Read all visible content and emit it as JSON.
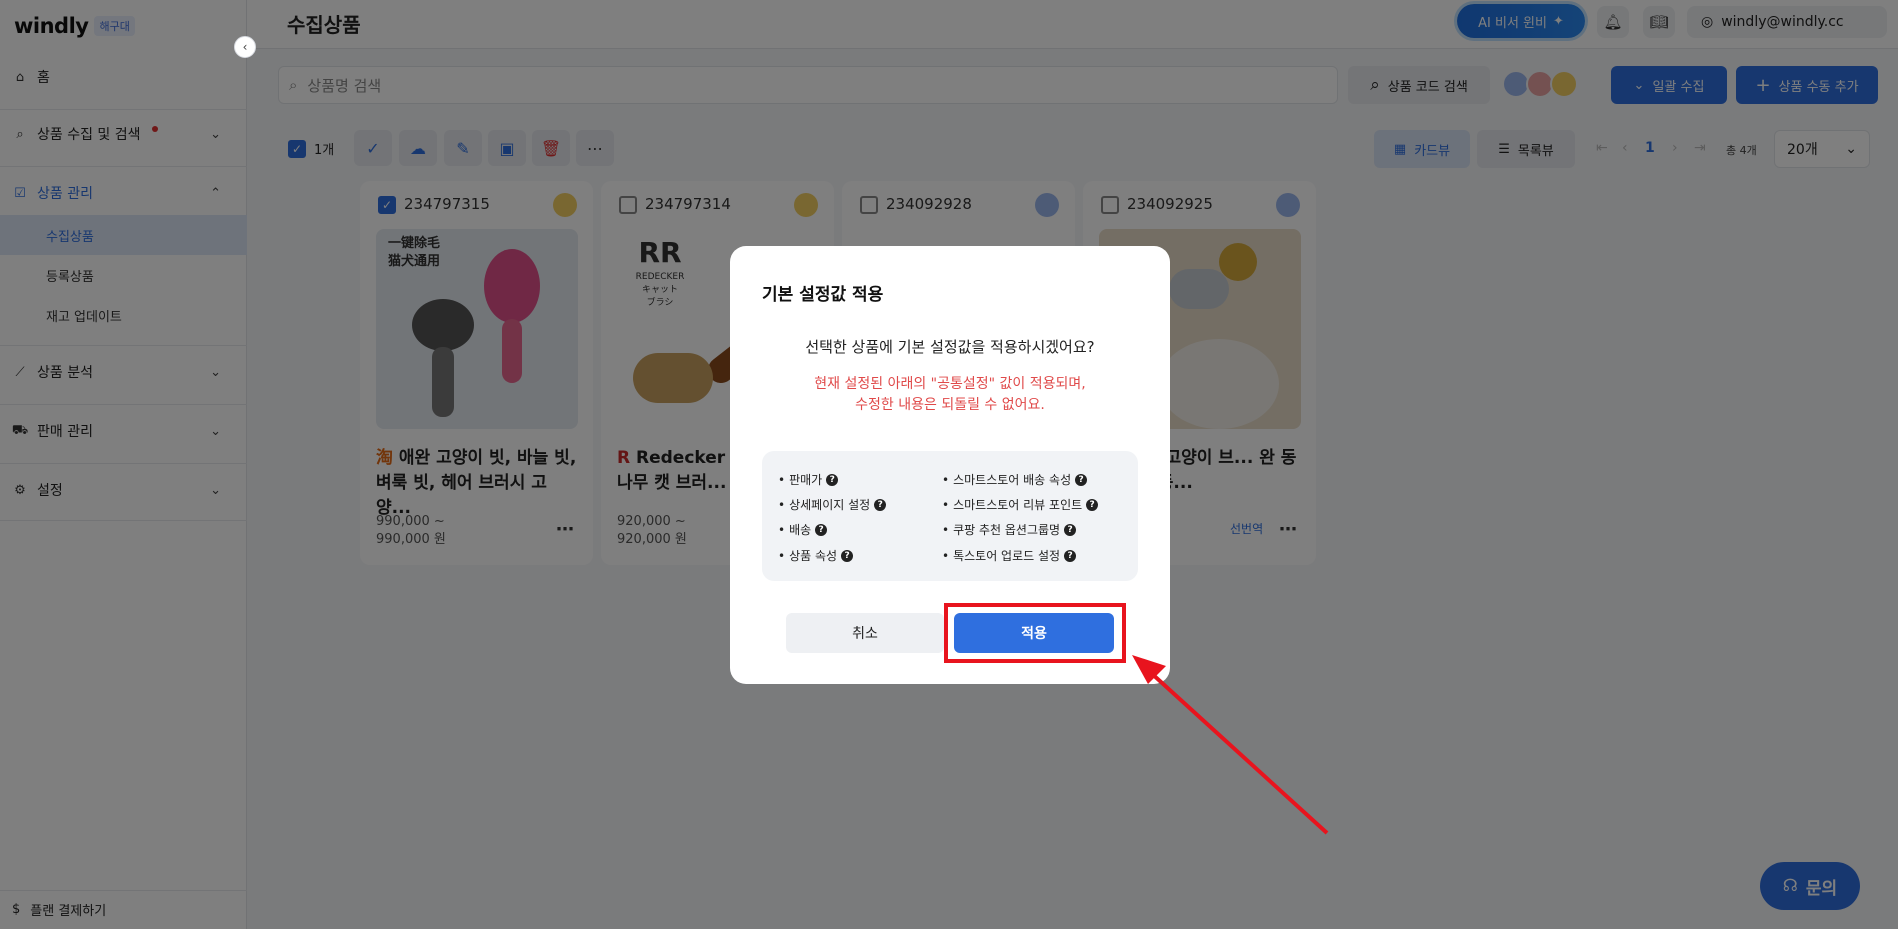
{
  "sidebar": {
    "logo": "windly",
    "badge": "해구대",
    "items": [
      {
        "label": "홈"
      },
      {
        "label": "상품 수집 및 검색"
      },
      {
        "label": "상품 관리"
      },
      {
        "label": "상품 분석"
      },
      {
        "label": "판매 관리"
      },
      {
        "label": "설정"
      }
    ],
    "sub_items": [
      {
        "label": "수집상품"
      },
      {
        "label": "등록상품"
      },
      {
        "label": "재고 업데이트"
      }
    ],
    "plan": "플랜 결제하기"
  },
  "header": {
    "title": "수집상품",
    "ai_button": "AI 비서 윈비",
    "user_email": "windly@windly.cc"
  },
  "toolbar": {
    "search_placeholder": "상품명 검색",
    "code_search": "상품 코드 검색",
    "bulk_collect": "일괄 수집",
    "manual_add": "상품 수동 추가",
    "selected_count": "1개",
    "card_view": "카드뷰",
    "list_view": "목록뷰",
    "page": "1",
    "total": "총 4개",
    "per_page": "20개"
  },
  "cards": [
    {
      "code": "234797315",
      "title": "애완 고양이 빗, 바늘 빗, 벼룩 빗, 헤어 브러시 고양...",
      "price_line1": "990,000 ~",
      "price_line2": "990,000 원",
      "checked": true
    },
    {
      "code": "234797314",
      "title": "Redecker 러... 천연 나무 캣 브러...",
      "price_line1": "920,000 ~",
      "price_line2": "920,000 원",
      "checked": false
    },
    {
      "code": "234092928",
      "title": "",
      "price_line1": "",
      "price_line2": "",
      "checked": false
    },
    {
      "code": "234092925",
      "title": "...1 위] 고양이 브... 완 동물 애완 동...",
      "price_line1": "",
      "price_line2": "",
      "extra": "선번역",
      "checked": false
    }
  ],
  "card1_img_text": [
    "一键除毛",
    "猫犬通用"
  ],
  "card2_img_text": [
    "REDECKER",
    "キャット",
    "ブラシ"
  ],
  "modal": {
    "title": "기본 설정값 적용",
    "question": "선택한 상품에 기본 설정값을 적용하시겠어요?",
    "warning_line1": "현재 설정된 아래의 \"공통설정\" 값이 적용되며,",
    "warning_line2": "수정한 내용은 되돌릴 수 없어요.",
    "settings_left": [
      "판매가",
      "상세페이지 설정",
      "배송",
      "상품 속성"
    ],
    "settings_right": [
      "스마트스토어 배송 속성",
      "스마트스토어 리뷰 포인트",
      "쿠팡 추천 옵션그룹명",
      "톡스토어 업로드 설정"
    ],
    "cancel": "취소",
    "apply": "적용"
  },
  "inquiry": "문의",
  "colors": {
    "primary": "#2f6fdf",
    "warning": "#e04a4a",
    "highlight": "#e8141e"
  }
}
